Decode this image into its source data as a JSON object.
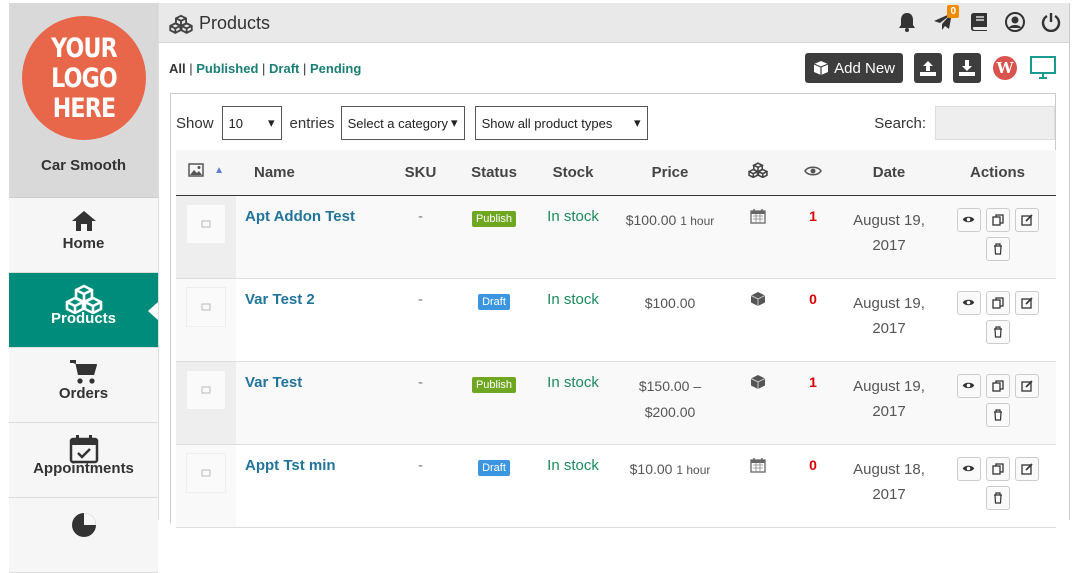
{
  "brand": {
    "logo_lines": [
      "YOUR",
      "LOGO",
      "HERE"
    ],
    "store_name": "Car Smooth",
    "logo_color": "#e8664a"
  },
  "sidebar": {
    "items": [
      {
        "label": "Home",
        "icon": "home-icon",
        "active": false
      },
      {
        "label": "Products",
        "icon": "cubes-icon",
        "active": true
      },
      {
        "label": "Orders",
        "icon": "cart-icon",
        "active": false
      },
      {
        "label": "Appointments",
        "icon": "calendar-check-icon",
        "active": false
      }
    ]
  },
  "header": {
    "title": "Products",
    "notification_badge": "0",
    "icons": [
      "bell-icon",
      "paper-plane-icon",
      "book-icon",
      "user-circle-icon",
      "power-icon"
    ]
  },
  "filters": {
    "all": "All",
    "published": "Published",
    "draft": "Draft",
    "pending": "Pending",
    "sep": "|"
  },
  "toolbar": {
    "add_new": "Add New"
  },
  "controls": {
    "show_label": "Show",
    "entries_value": "10",
    "entries_label": "entries",
    "category": "Select a category",
    "types": "Show all product types",
    "search_label": "Search:"
  },
  "table": {
    "headers": {
      "name": "Name",
      "sku": "SKU",
      "status": "Status",
      "stock": "Stock",
      "price": "Price",
      "date": "Date",
      "actions": "Actions"
    },
    "rows": [
      {
        "name": "Apt Addon Test",
        "sku": "-",
        "status": "Publish",
        "stock": "In stock",
        "price": "$100.00",
        "price_suffix": "1 hour",
        "price_line2": "",
        "type": "calendar",
        "views": "1",
        "date_line1": "August 19,",
        "date_line2": "2017"
      },
      {
        "name": "Var Test 2",
        "sku": "-",
        "status": "Draft",
        "stock": "In stock",
        "price": "$100.00",
        "price_suffix": "",
        "price_line2": "",
        "type": "variable",
        "views": "0",
        "date_line1": "August 19,",
        "date_line2": "2017"
      },
      {
        "name": "Var Test",
        "sku": "-",
        "status": "Publish",
        "stock": "In stock",
        "price": "$150.00 –",
        "price_suffix": "",
        "price_line2": "$200.00",
        "type": "variable",
        "views": "1",
        "date_line1": "August 19,",
        "date_line2": "2017"
      },
      {
        "name": "Appt Tst min",
        "sku": "-",
        "status": "Draft",
        "stock": "In stock",
        "price": "$10.00",
        "price_suffix": "1 hour",
        "price_line2": "",
        "type": "calendar",
        "views": "0",
        "date_line1": "August 18,",
        "date_line2": "2017"
      }
    ]
  },
  "colors": {
    "accent": "#008c7a",
    "publish": "#6fa721",
    "draft": "#3b95e0",
    "link": "#21759b"
  }
}
